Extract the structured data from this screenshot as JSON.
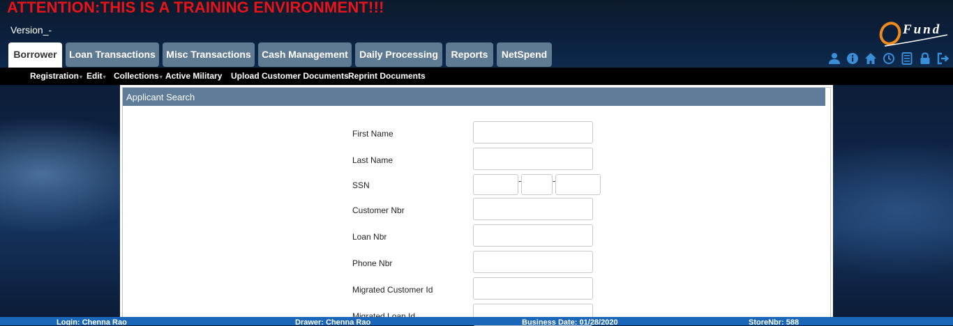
{
  "banner": {
    "attention": "ATTENTION:THIS IS A TRAINING ENVIRONMENT!!!",
    "version": "Version_-"
  },
  "logo": {
    "text": "Fund"
  },
  "tabs": [
    {
      "label": "Borrower",
      "active": true
    },
    {
      "label": "Loan Transactions"
    },
    {
      "label": "Misc Transactions"
    },
    {
      "label": "Cash Management"
    },
    {
      "label": "Daily Processing"
    },
    {
      "label": "Reports"
    },
    {
      "label": "NetSpend"
    }
  ],
  "toolbar_icons": [
    "user-icon",
    "info-icon",
    "home-icon",
    "clock-icon",
    "calculator-icon",
    "lock-icon",
    "logout-icon"
  ],
  "subnav": [
    {
      "label": "Registration",
      "has_menu": true
    },
    {
      "label": "Edit",
      "has_menu": true
    },
    {
      "label": "Collections",
      "has_menu": true
    },
    {
      "label": "Active Military",
      "has_menu": false
    },
    {
      "label": "Upload Customer Documents",
      "has_menu": false
    },
    {
      "label": "Reprint Documents",
      "has_menu": false
    }
  ],
  "panel": {
    "title": "Applicant Search",
    "fields": [
      {
        "label": "First Name",
        "value": ""
      },
      {
        "label": "Last Name",
        "value": ""
      },
      {
        "label": "SSN",
        "value": ""
      },
      {
        "label": "Customer Nbr",
        "value": ""
      },
      {
        "label": "Loan Nbr",
        "value": ""
      },
      {
        "label": "Phone Nbr",
        "value": ""
      },
      {
        "label": "Migrated Customer Id",
        "value": ""
      },
      {
        "label": "Migrated Loan Id",
        "value": ""
      }
    ],
    "ssn_separator": "-"
  },
  "footer": {
    "login": "Login: Chenna Rao",
    "drawer": "Drawer: Chenna Rao",
    "business_date": "Business Date: 01/28/2020",
    "store": "StoreNbr: 588"
  },
  "colors": {
    "accent": "#5f7a93",
    "banner_red": "#e8141a",
    "footer_blue": "#1a66b8",
    "icon_blue": "#3a8fd8"
  }
}
